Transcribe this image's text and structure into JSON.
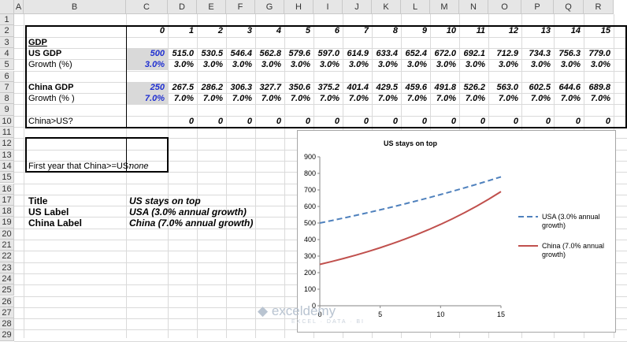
{
  "columns": [
    "A",
    "B",
    "C",
    "D",
    "E",
    "F",
    "G",
    "H",
    "I",
    "J",
    "K",
    "L",
    "M",
    "N",
    "O",
    "P",
    "Q",
    "R"
  ],
  "rows": [
    "1",
    "2",
    "3",
    "4",
    "5",
    "6",
    "7",
    "8",
    "9",
    "10",
    "11",
    "12",
    "13",
    "14",
    "15",
    "16",
    "17",
    "18",
    "19",
    "20",
    "21",
    "22",
    "23",
    "24",
    "25",
    "26",
    "27",
    "28",
    "29"
  ],
  "years": [
    "0",
    "1",
    "2",
    "3",
    "4",
    "5",
    "6",
    "7",
    "8",
    "9",
    "10",
    "11",
    "12",
    "13",
    "14",
    "15"
  ],
  "gdp_label": "GDP",
  "us_gdp": {
    "label": "US GDP",
    "values": [
      "500",
      "515.0",
      "530.5",
      "546.4",
      "562.8",
      "579.6",
      "597.0",
      "614.9",
      "633.4",
      "652.4",
      "672.0",
      "692.1",
      "712.9",
      "734.3",
      "756.3",
      "779.0"
    ]
  },
  "us_growth": {
    "label": "Growth (%)",
    "values": [
      "3.0%",
      "3.0%",
      "3.0%",
      "3.0%",
      "3.0%",
      "3.0%",
      "3.0%",
      "3.0%",
      "3.0%",
      "3.0%",
      "3.0%",
      "3.0%",
      "3.0%",
      "3.0%",
      "3.0%",
      "3.0%"
    ]
  },
  "china_gdp": {
    "label": "China GDP",
    "values": [
      "250",
      "267.5",
      "286.2",
      "306.3",
      "327.7",
      "350.6",
      "375.2",
      "401.4",
      "429.5",
      "459.6",
      "491.8",
      "526.2",
      "563.0",
      "602.5",
      "644.6",
      "689.8"
    ]
  },
  "china_growth": {
    "label": "Growth (% )",
    "values": [
      "7.0%",
      "7.0%",
      "7.0%",
      "7.0%",
      "7.0%",
      "7.0%",
      "7.0%",
      "7.0%",
      "7.0%",
      "7.0%",
      "7.0%",
      "7.0%",
      "7.0%",
      "7.0%",
      "7.0%",
      "7.0%"
    ]
  },
  "compare": {
    "label": "China>US?",
    "values": [
      "",
      "0",
      "0",
      "0",
      "0",
      "0",
      "0",
      "0",
      "0",
      "0",
      "0",
      "0",
      "0",
      "0",
      "0",
      "0"
    ]
  },
  "first_year": {
    "label": "First year that China>=US:",
    "value": "none"
  },
  "labels_section": [
    {
      "key": "Title",
      "value": "US stays on top"
    },
    {
      "key": "US Label",
      "value": "USA (3.0% annual growth)"
    },
    {
      "key": "China Label",
      "value": "China (7.0% annual growth)"
    }
  ],
  "watermark": {
    "name": "exceldemy",
    "tagline": "EXCEL · DATA · BI"
  },
  "chart_data": {
    "type": "line",
    "title": "US stays on top",
    "x": [
      0,
      1,
      2,
      3,
      4,
      5,
      6,
      7,
      8,
      9,
      10,
      11,
      12,
      13,
      14,
      15
    ],
    "xlim": [
      0,
      15
    ],
    "ylim": [
      0,
      900
    ],
    "xticks": [
      "0",
      "5",
      "10",
      "15"
    ],
    "yticks": [
      "0",
      "100",
      "200",
      "300",
      "400",
      "500",
      "600",
      "700",
      "800",
      "900"
    ],
    "grid": false,
    "legend": "right",
    "series": [
      {
        "name": "USA (3.0% annual growth)",
        "legend_lines": [
          "USA (3.0% annual",
          "growth)"
        ],
        "color": "#4f81bd",
        "dash": true,
        "values": [
          500,
          515.0,
          530.5,
          546.4,
          562.8,
          579.6,
          597.0,
          614.9,
          633.4,
          652.4,
          672.0,
          692.1,
          712.9,
          734.3,
          756.3,
          779.0
        ]
      },
      {
        "name": "China (7.0% annual growth)",
        "legend_lines": [
          "China (7.0% annual",
          "growth)"
        ],
        "color": "#c0504d",
        "dash": false,
        "values": [
          250,
          267.5,
          286.2,
          306.3,
          327.7,
          350.6,
          375.2,
          401.4,
          429.5,
          459.6,
          491.8,
          526.2,
          563.0,
          602.5,
          644.6,
          689.8
        ]
      }
    ]
  }
}
